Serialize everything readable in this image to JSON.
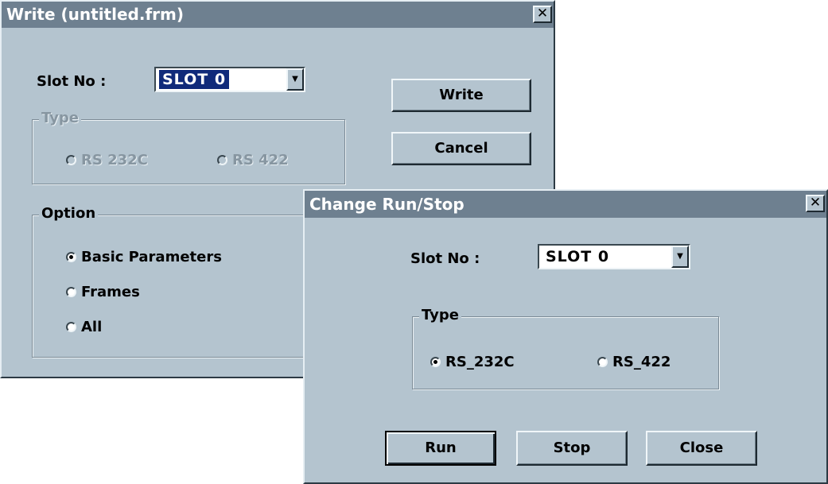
{
  "write_dialog": {
    "title": "Write (untitled.frm)",
    "close_label": "✕",
    "slot_label": "Slot No :",
    "slot_value": "SLOT 0",
    "dropdown_arrow": "▼",
    "write_button": "Write",
    "cancel_button": "Cancel",
    "type_group": {
      "title": "Type",
      "options": [
        "RS 232C",
        "RS 422"
      ]
    },
    "option_group": {
      "title": "Option",
      "options": [
        "Basic Parameters",
        "Frames",
        "All"
      ],
      "selected": "Basic Parameters"
    }
  },
  "run_stop_dialog": {
    "title": "Change Run/Stop",
    "close_label": "✕",
    "slot_label": "Slot No :",
    "slot_value": "SLOT 0",
    "dropdown_arrow": "▼",
    "type_group": {
      "title": "Type",
      "options": [
        "RS_232C",
        "RS_422"
      ],
      "selected": "RS_232C"
    },
    "buttons": {
      "run": "Run",
      "stop": "Stop",
      "close": "Close"
    }
  },
  "colors": {
    "window_face": "#b4c4cf",
    "title_bar": "#6e8090",
    "selection": "#102a7a",
    "disabled_text": "#8796a1"
  }
}
